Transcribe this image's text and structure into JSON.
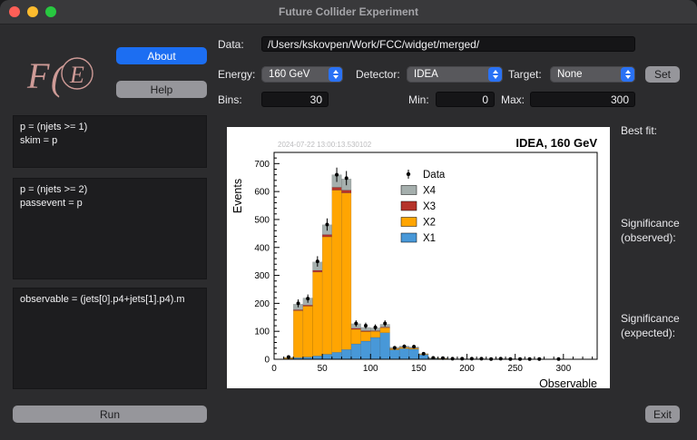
{
  "window": {
    "title": "Future Collider Experiment"
  },
  "logo": {
    "f": "F",
    "paren": "(",
    "e": "E"
  },
  "left": {
    "about_label": "About",
    "help_label": "Help",
    "run_label": "Run",
    "code_boxes": [
      {
        "text": "p = (njets >= 1)\nskim = p"
      },
      {
        "text": "p = (njets >= 2)\npassevent = p"
      },
      {
        "text": "observable = (jets[0].p4+jets[1].p4).m"
      }
    ]
  },
  "controls": {
    "data_label": "Data:",
    "data_value": "/Users/kskovpen/Work/FCC/widget/merged/",
    "energy_label": "Energy:",
    "energy_value": "160 GeV",
    "detector_label": "Detector:",
    "detector_value": "IDEA",
    "target_label": "Target:",
    "target_value": "None",
    "set_label": "Set",
    "bins_label": "Bins:",
    "bins_value": "30",
    "min_label": "Min:",
    "min_value": "0",
    "max_label": "Max:",
    "max_value": "300"
  },
  "results": {
    "best_fit": "Best fit:",
    "sig_obs": "Significance (observed):",
    "sig_exp": "Significance (expected):"
  },
  "exit_label": "Exit",
  "chart_data": {
    "type": "bar",
    "stacked": true,
    "title": "IDEA, 160 GeV",
    "timestamp": "2024-07-22 13:00:13.530102",
    "xlabel": "Observable",
    "ylabel": "Events",
    "xlim": [
      0,
      300
    ],
    "ylim": [
      0,
      700
    ],
    "x_tick_step": 50,
    "y_tick_step": 100,
    "bin_width": 10,
    "grid": false,
    "legend_position": "top-right",
    "legend": [
      "Data",
      "X4",
      "X3",
      "X2",
      "X1"
    ],
    "series": [
      {
        "name": "X1",
        "color": "#4898d8",
        "values": [
          0,
          2,
          6,
          8,
          12,
          18,
          25,
          35,
          55,
          65,
          78,
          95,
          34,
          38,
          36,
          16,
          3,
          2,
          1,
          1,
          0,
          1,
          0,
          0,
          1,
          0,
          0,
          0,
          0,
          0
        ]
      },
      {
        "name": "X2",
        "color": "#ffa502",
        "values": [
          0,
          3,
          168,
          182,
          300,
          420,
          580,
          560,
          52,
          34,
          22,
          18,
          4,
          4,
          3,
          2,
          1,
          1,
          0,
          0,
          1,
          0,
          0,
          1,
          0,
          0,
          0,
          0,
          0,
          0
        ]
      },
      {
        "name": "X3",
        "color": "#b5332a",
        "values": [
          0,
          0,
          3,
          4,
          6,
          8,
          10,
          10,
          4,
          3,
          2,
          2,
          1,
          1,
          1,
          0,
          0,
          0,
          0,
          0,
          0,
          0,
          0,
          0,
          0,
          0,
          0,
          0,
          0,
          0
        ]
      },
      {
        "name": "X4",
        "color": "#a5afad",
        "values": [
          0,
          2,
          20,
          25,
          30,
          35,
          45,
          40,
          16,
          12,
          10,
          10,
          4,
          4,
          4,
          2,
          1,
          1,
          1,
          1,
          1,
          1,
          1,
          1,
          1,
          1,
          0,
          1,
          0,
          1
        ]
      }
    ],
    "data_points": {
      "name": "Data",
      "color": "#000000",
      "values": [
        0,
        8,
        200,
        217,
        350,
        482,
        660,
        648,
        128,
        120,
        114,
        128,
        41,
        46,
        45,
        20,
        5,
        4,
        2,
        2,
        2,
        2,
        1,
        2,
        1,
        1,
        1,
        1,
        0,
        1
      ]
    }
  }
}
